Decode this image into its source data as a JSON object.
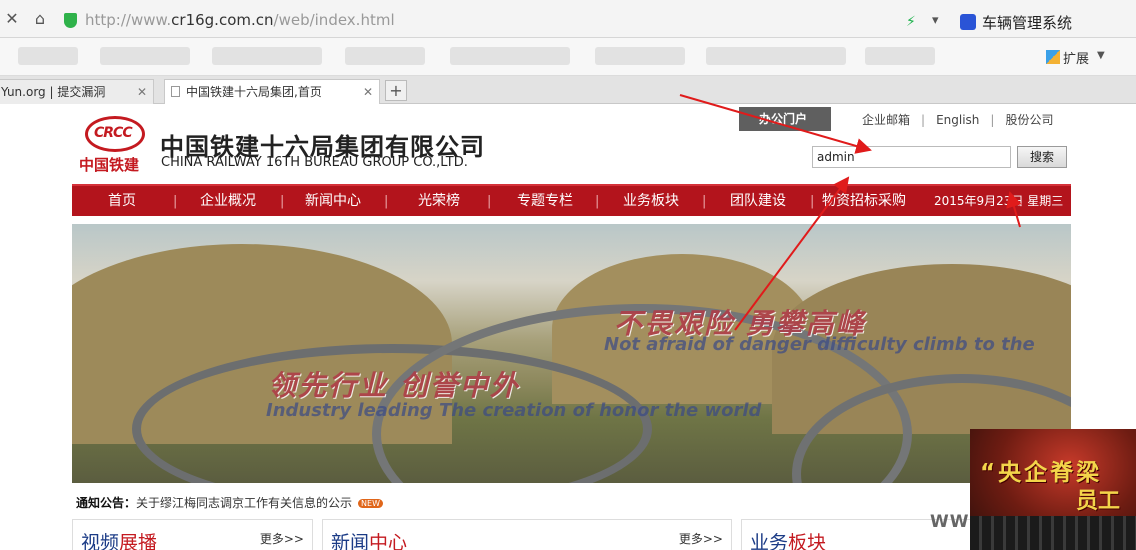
{
  "browser": {
    "address": {
      "scheme": "http://www.",
      "host": "cr16g.com.cn",
      "path": "/web/index.html"
    },
    "search_engine_text": "车辆管理系统",
    "extensions_label": "扩展",
    "tabs": [
      {
        "label": "Yun.org | 提交漏洞"
      },
      {
        "label": "中国铁建十六局集团,首页"
      }
    ]
  },
  "site": {
    "logo_abbr": "CRCC",
    "logo_sub": "中国铁建",
    "company_cn": "中国铁建十六局集团有限公司",
    "company_en": "CHINA RAILWAY 16TH BUREAU GROUP CO.,LTD.",
    "portal_label": "办公门户",
    "top_links": [
      "企业邮箱",
      "English",
      "股份公司"
    ],
    "search": {
      "value": "admin",
      "button": "搜索"
    },
    "nav": [
      "首页",
      "企业概况",
      "新闻中心",
      "光荣榜",
      "专题专栏",
      "业务板块",
      "团队建设",
      "物资招标采购"
    ],
    "date": "2015年9月23日 星期三",
    "banner": {
      "slogan1_cn": "不畏艰险  勇攀高峰",
      "slogan1_en": "Not afraid of danger difficulty climb to the",
      "slogan2_cn": "领先行业  创誉中外",
      "slogan2_en": "Industry leading  The creation of honor the world"
    },
    "notice": {
      "label": "通知公告：",
      "text": "关于缪江梅同志调京工作有关信息的公示",
      "badge": "NEW"
    },
    "sections": [
      {
        "title_a": "视频",
        "title_b": "展播",
        "more": "更多>>"
      },
      {
        "title_a": "新闻",
        "title_b": "中心",
        "more": "更多>>"
      },
      {
        "title_a": "业务",
        "title_b": "板块",
        "more": ""
      }
    ],
    "ad": {
      "line1": "“央企脊梁",
      "line2": "员工",
      "www": "WWW"
    }
  }
}
